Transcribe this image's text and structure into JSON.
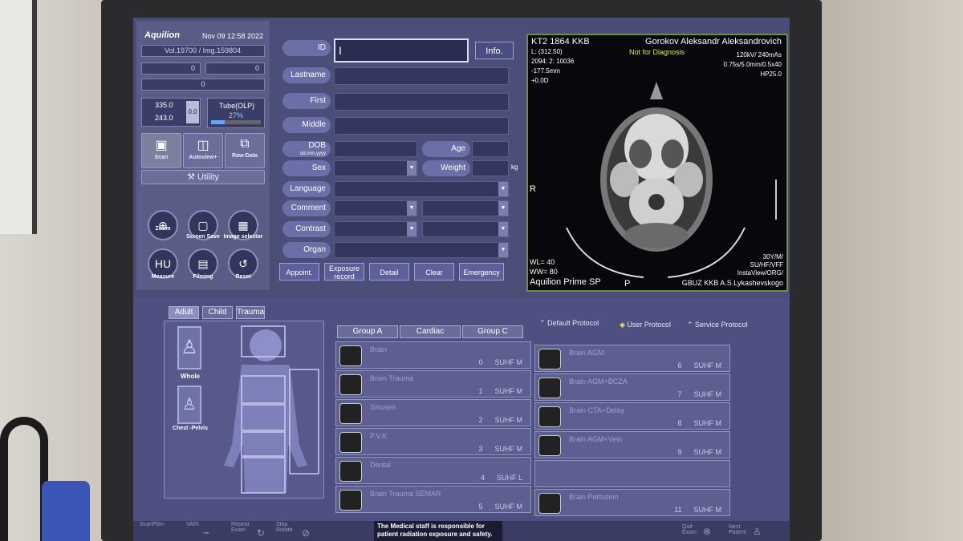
{
  "header": {
    "brand": "Aquilion",
    "datetime": "Nov 09 12:58 2022",
    "vol": "Vol.19700",
    "img": "/ Img.159804",
    "count_a": "0",
    "count_b": "0",
    "count_c": "0",
    "val_upper": "335.0",
    "val_lower": "243.0",
    "val_side": "0.0",
    "tube_label": "Tube(OLP)",
    "tube_pct": "27%",
    "tube_fill_pct": 27
  },
  "left_icons": {
    "scan": "Scan",
    "autoview": "Autoview+",
    "raw": "Raw-Data",
    "utility": "Utility",
    "zoom": "Zoom",
    "screen_save": "Screen Save",
    "image_selector": "Image selector",
    "measure": "Measure",
    "filming": "Filming",
    "reset": "Reset"
  },
  "form": {
    "id_label": "ID",
    "info_btn": "Info.",
    "lastname": "Lastname",
    "first": "First",
    "middle": "Middle",
    "dob": "DOB",
    "dob_fmt": "dd.mm.yyyy",
    "age": "Age",
    "sex": "Sex",
    "weight": "Weight",
    "kg": "kg",
    "language": "Language",
    "comment": "Comment",
    "contrast": "Contrast",
    "organ": "Organ",
    "btn_appoint": "Appoint.",
    "btn_exposure": "Exposure record",
    "btn_detail": "Detail",
    "btn_clear": "Clear",
    "btn_emergency": "Emergency"
  },
  "viewer": {
    "tl1": "KT2 1864 KKB",
    "tl2": "L: (312.50)",
    "tl3": "2094: 2: 10036",
    "tl4": "-177.5mm",
    "tl5": "+0.0D",
    "patient": "Gorokov Aleksandr Aleksandrovich",
    "warning": "Not for Diagnosis",
    "tr1": "120kV/ 240mAs",
    "tr2": "0.75s/5.0mm/0.5x40",
    "tr3": "HP25.0",
    "left_marker": "R",
    "bottom_marker": "P",
    "wl": "WL= 40",
    "ww": "WW= 80",
    "model": "Aquilion Prime SP",
    "br1": "30Y/M/",
    "br2": "SU/HF/VFF",
    "br3": "InstaView/ORG/",
    "br4": "GBUZ KKB A.S.Lykashevskogo"
  },
  "lower": {
    "tab_adult": "Adult",
    "tab_child": "Child",
    "tab_trauma": "Trauma",
    "whole": "Whole",
    "chest": "Chest -Pelvis",
    "group_a": "Group A",
    "cardiac": "Cardiac",
    "group_c": "Group C",
    "default_protocol": "Default Protocol",
    "user_protocol": "User Protocol",
    "service_protocol": "Service Protocol",
    "protocols_left": [
      {
        "name": "Brain",
        "num": "0",
        "tag": "SUHF  M"
      },
      {
        "name": "Brain Trauma",
        "num": "1",
        "tag": "SUHF  M"
      },
      {
        "name": "Sinuses",
        "num": "2",
        "tag": "SUHF  M"
      },
      {
        "name": "P.V.K",
        "num": "3",
        "tag": "SUHF  M"
      },
      {
        "name": "Dental",
        "num": "4",
        "tag": "SUHF  L"
      },
      {
        "name": "Brain Trauma SEMAR",
        "num": "5",
        "tag": "SUHF  M"
      }
    ],
    "protocols_right": [
      {
        "name": "Brain AGM",
        "num": "6",
        "tag": "SUHF  M"
      },
      {
        "name": "Brain AGM+BCZA",
        "num": "7",
        "tag": "SUHF  M"
      },
      {
        "name": "Brain CTA+Delay",
        "num": "8",
        "tag": "SUHF  M"
      },
      {
        "name": "Brain AGM+Vein",
        "num": "9",
        "tag": "SUHF  M"
      },
      {
        "name": "",
        "num": "",
        "tag": ""
      },
      {
        "name": "Brain Perfusion",
        "num": "11",
        "tag": "SUHF  M"
      }
    ]
  },
  "footer": {
    "scanplan": "ScanPlan",
    "vari": "VARI",
    "repeat": "Repeat Exam",
    "stop": "Stop Rotate",
    "notice": "The Medical staff is responsible for patient radiation exposure and safety.",
    "quit": "Quit Exam",
    "next": "Next Patient"
  }
}
